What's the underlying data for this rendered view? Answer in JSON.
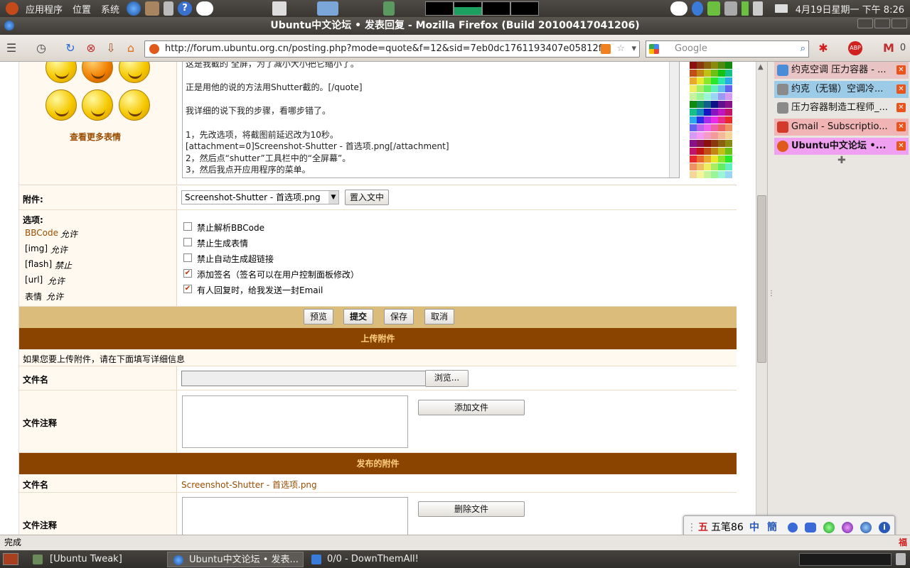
{
  "top_panel": {
    "menus": [
      "应用程序",
      "位置",
      "系统"
    ],
    "clock": "4月19日星期一 下午 8:26"
  },
  "window": {
    "title": "Ubuntu中文论坛 • 发表回复 - Mozilla Firefox (Build 20100417041206)"
  },
  "navbar": {
    "url": "http://forum.ubuntu.org.cn/posting.php?mode=quote&f=12&sid=7eb0dc1761193407e05812f",
    "search_placeholder": "Google",
    "mail_count": "0"
  },
  "editor": {
    "more_smilies": "查看更多表情",
    "message_lines": [
      "这是我截的 全屏，为了减小大小把它缩小了。",
      "",
      "正是用他的说的方法用Shutter截的。[/quote]",
      "",
      "我详细的说下我的步骤，看哪步错了。",
      "",
      "1，先改选项，将截图前延迟改为10秒。",
      "[attachment=0]Screenshot-Shutter - 首选项.png[/attachment]",
      "2，然后点“shutter”工具栏中的“全屏幕”。",
      "3，然后我点开应用程序的菜单。"
    ]
  },
  "attachment_row": {
    "label": "附件:",
    "selected": "Screenshot-Shutter - 首选项.png",
    "place_button": "置入文中"
  },
  "options": {
    "label": "选项:",
    "bbcode_link": "BBCode",
    "bbcode_state": "允许",
    "img": "[img]",
    "img_state": "允许",
    "flash": "[flash]",
    "flash_state": "禁止",
    "url": "[url]",
    "url_state": "允许",
    "smilies": "表情",
    "smilies_state": "允许",
    "checkboxes": [
      {
        "label": "禁止解析BBCode",
        "checked": false
      },
      {
        "label": "禁止生成表情",
        "checked": false
      },
      {
        "label": "禁止自动生成超链接",
        "checked": false
      },
      {
        "label": "添加签名（签名可以在用户控制面板修改）",
        "checked": true
      },
      {
        "label": "有人回复时，给我发送一封Email",
        "checked": true
      }
    ]
  },
  "actions": {
    "preview": "预览",
    "submit": "提交",
    "save": "保存",
    "cancel": "取消"
  },
  "upload": {
    "header": "上传附件",
    "hint": "如果您要上传附件，请在下面填写详细信息",
    "filename_label": "文件名",
    "browse": "浏览...",
    "comment_label": "文件注释",
    "add_file": "添加文件"
  },
  "posted": {
    "header": "发布的附件",
    "filename_label": "文件名",
    "filename": "Screenshot-Shutter - 首选项.png",
    "comment_label": "文件注释",
    "delete_file": "删除文件"
  },
  "sidebar_tabs": [
    {
      "label": "约克空调 压力容器 - ...",
      "color": "#e8c4c4",
      "fav": "#4a8cd8"
    },
    {
      "label": "约克（无锡）空调冷...",
      "color": "#9ccbe8",
      "fav": "#8a8a8a"
    },
    {
      "label": "压力容器制造工程师_...",
      "color": "#e8e6e2",
      "fav": "#8a8a8a"
    },
    {
      "label": "Gmail - Subscriptio...",
      "color": "#f0b4b4",
      "fav": "#d43a2a"
    },
    {
      "label": "Ubuntu中文论坛 •...",
      "color": "#f0a0f0",
      "fav": "#e05a1c",
      "bold": true
    }
  ],
  "status": {
    "text": "完成"
  },
  "taskbar": {
    "items": [
      "[Ubuntu Tweak]",
      "Ubuntu中文论坛 • 发表...",
      "0/0 - DownThemAll!"
    ]
  },
  "ime": {
    "mode": "五笔86",
    "glyph1": "中",
    "glyph2": "簡"
  }
}
